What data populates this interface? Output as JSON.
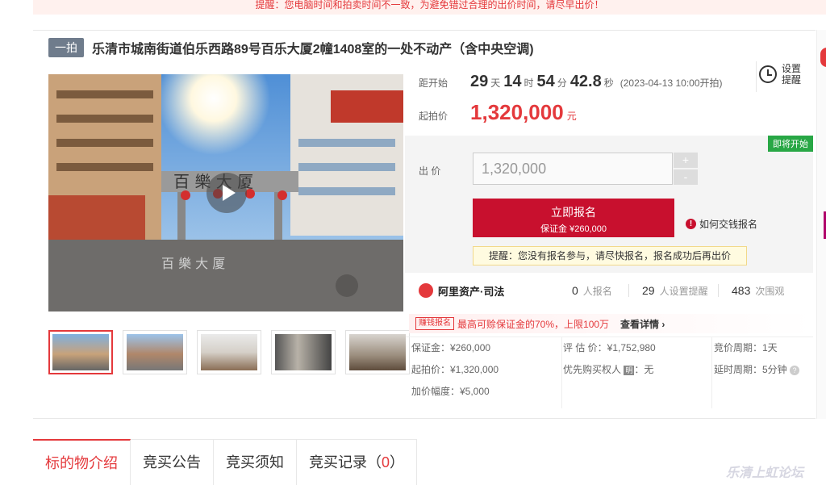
{
  "notice": "提醒：您电脑时间和拍卖时间不一致，为避免错过合理的出价时间，请尽早出价！",
  "listing": {
    "tag": "一拍",
    "title": "乐清市城南街道伯乐西路89号百乐大厦2幢1408室的一处不动产（含中央空调)"
  },
  "countdown": {
    "label": "距开始",
    "days": "29",
    "days_unit": "天",
    "hours": "14",
    "hours_unit": "时",
    "minutes": "54",
    "minutes_unit": "分",
    "seconds": "42.8",
    "seconds_unit": "秒",
    "start_time": "(2023-04-13 10:00开拍)"
  },
  "remind": {
    "line1": "设置",
    "line2": "提醒"
  },
  "start_price": {
    "label": "起拍价",
    "value": "1,320,000",
    "unit": "元"
  },
  "bid": {
    "badge": "即将开始",
    "label": "出 价",
    "placeholder": "1,320,000",
    "plus": "+",
    "minus": "-",
    "signup_label": "立即报名",
    "deposit_label": "保证金 ¥260,000",
    "pay_help": "如何交钱报名",
    "reminder": "提醒：您没有报名参与，请尽快报名，报名成功后再出价"
  },
  "stats": {
    "brand": "阿里资产·司法",
    "signups": "0",
    "signups_label": "人报名",
    "reminders": "29",
    "reminders_label": "人设置提醒",
    "views": "483",
    "views_label": "次围观"
  },
  "promo": {
    "tag": "赚钱报名",
    "text": "最高可赊保证金的70%，上限100万",
    "link": "查看详情 ›"
  },
  "details": {
    "deposit": "保证金：¥260,000",
    "start_price": "起拍价：¥1,320,000",
    "increment": "加价幅度：¥5,000",
    "appraisal": "评 估 价：¥1,752,980",
    "priority_label": "优先购买权人",
    "priority_tag": "明",
    "priority_value": "：无",
    "cycle": "竞价周期：1天",
    "delay": "延时周期：5分钟",
    "help_icon": "?"
  },
  "tabs": [
    {
      "label": "标的物介绍"
    },
    {
      "label": "竞买公告"
    },
    {
      "label": "竞买须知"
    },
    {
      "label": "竞买记录（",
      "count": "0",
      "close": "）"
    }
  ],
  "watermark": "乐清上虹论坛"
}
